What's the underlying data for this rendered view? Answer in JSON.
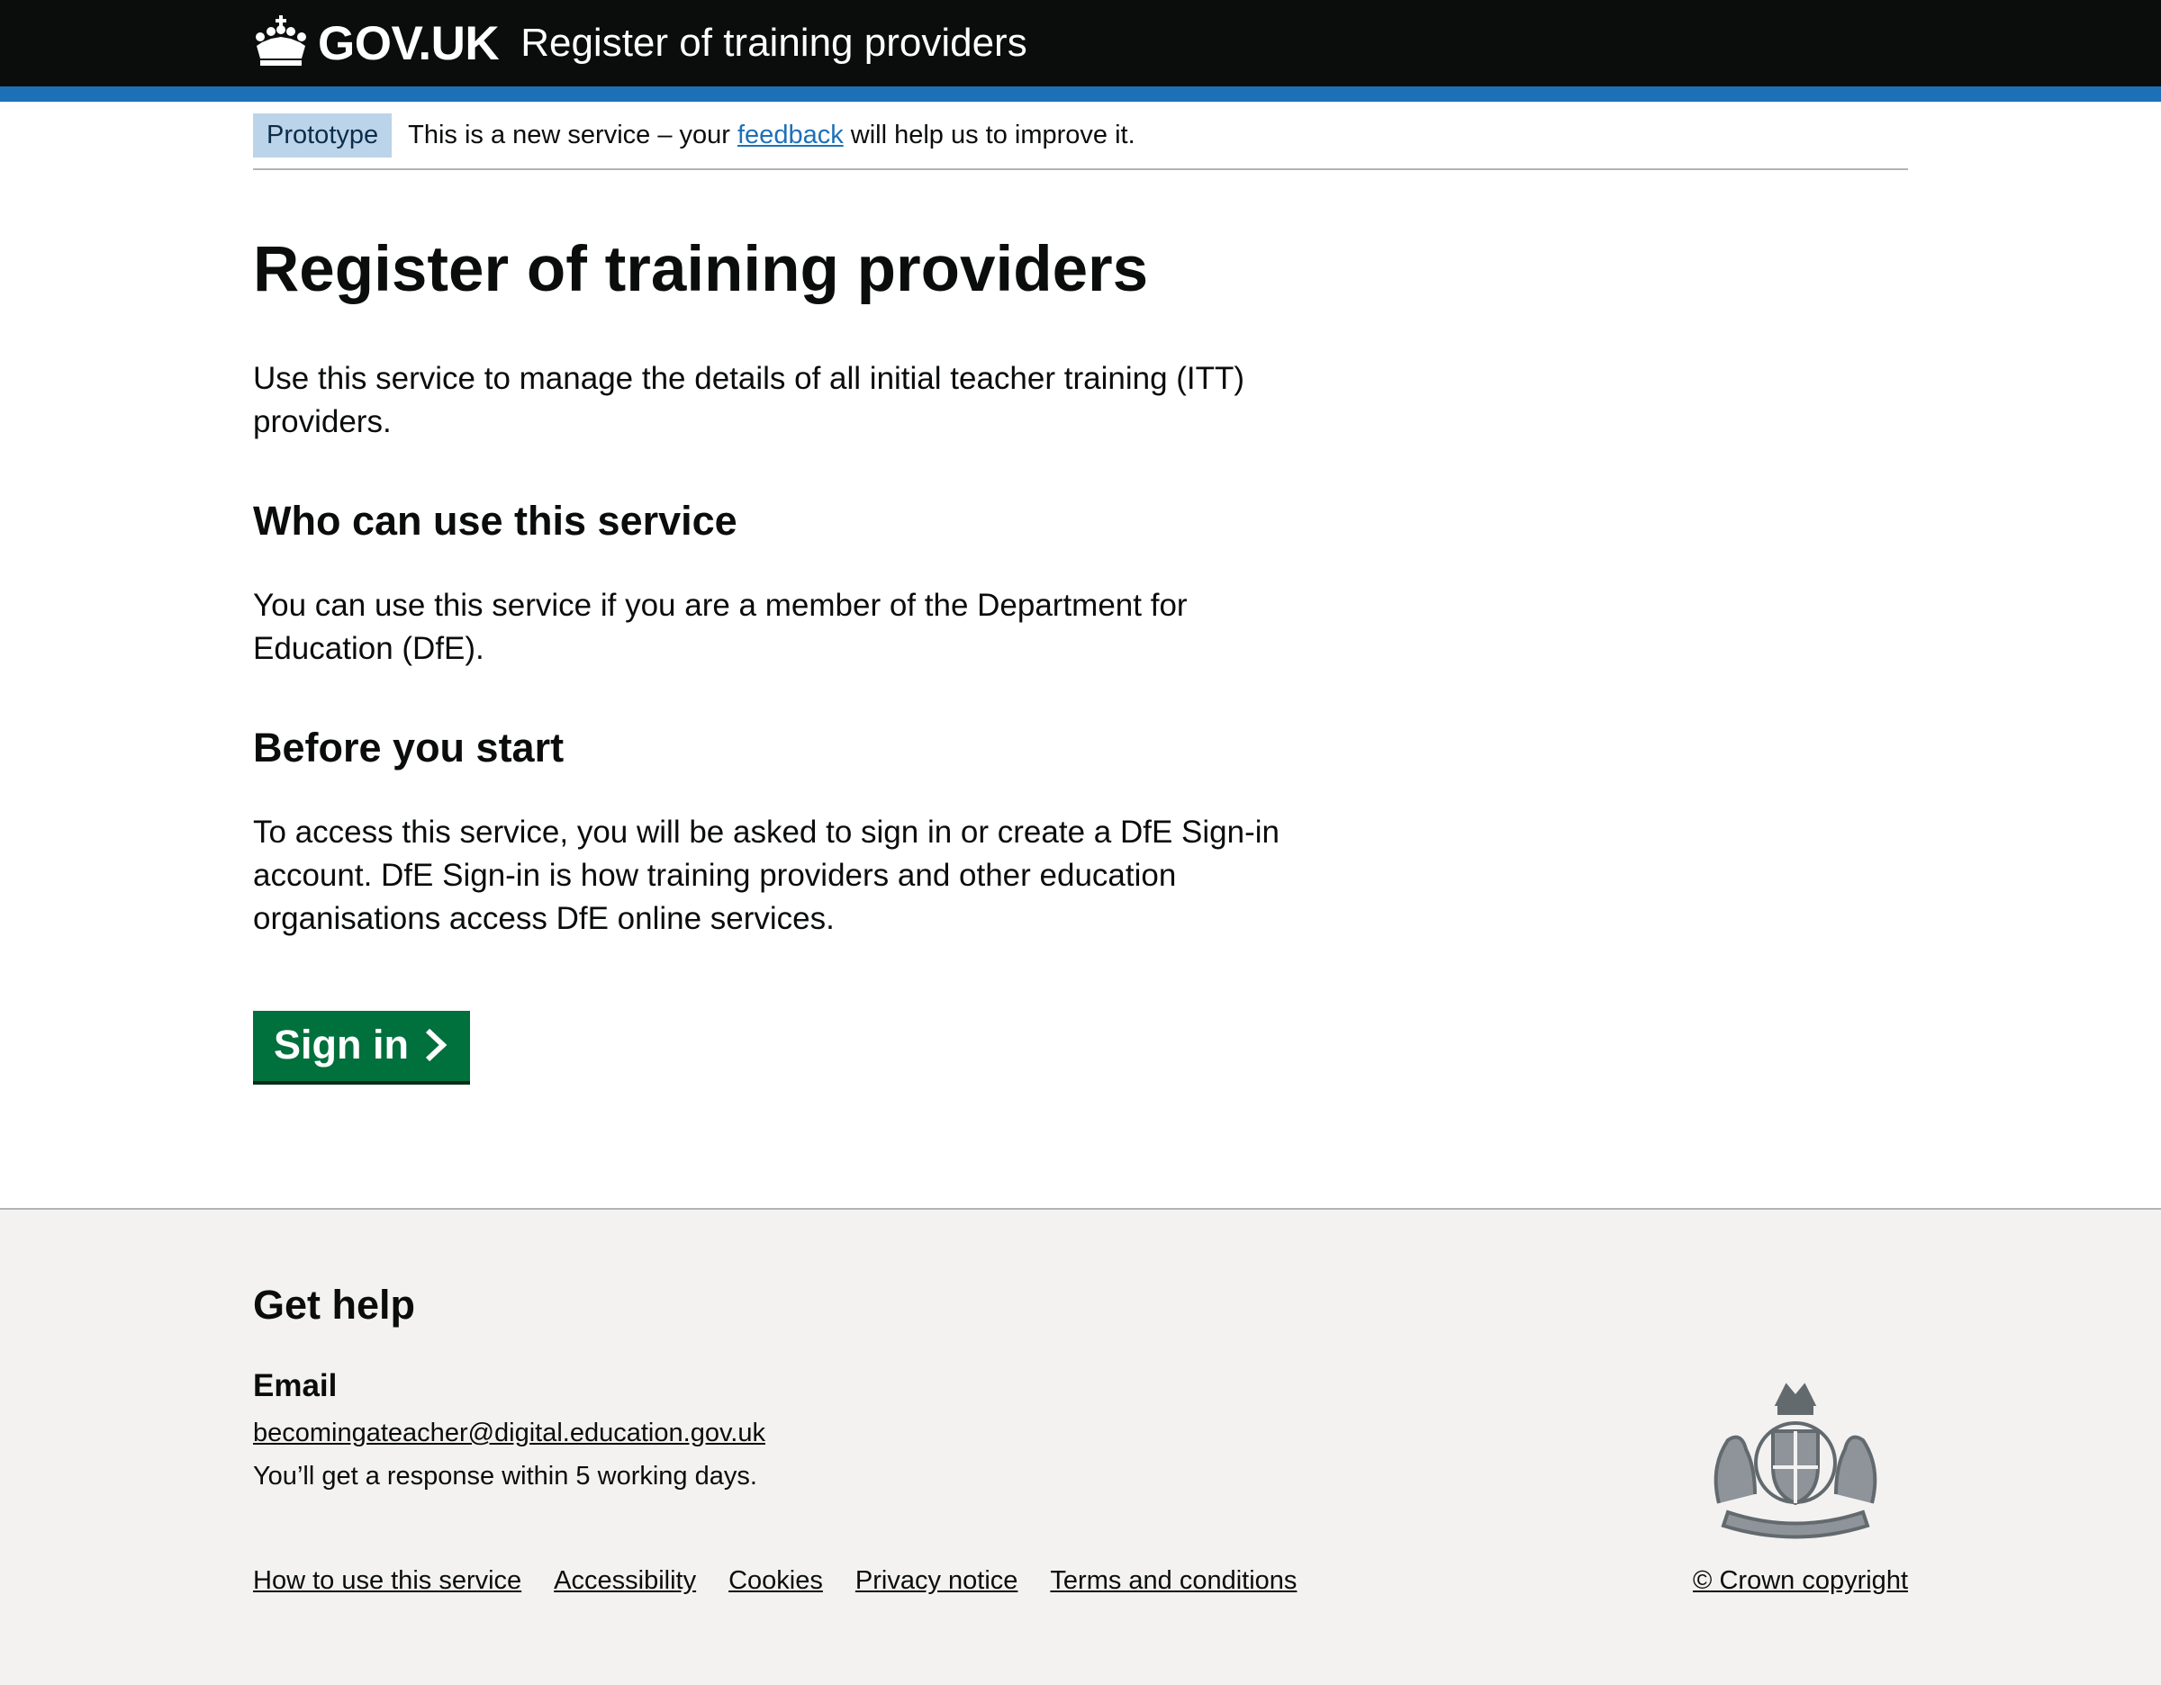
{
  "header": {
    "logo_text": "GOV.UK",
    "service_name": "Register of training providers",
    "accent_color": "#1d70b8",
    "background_color": "#0b0c0c"
  },
  "phase_banner": {
    "tag": "Prototype",
    "text_before": "This is a new service – your ",
    "link_text": "feedback",
    "text_after": " will help us to improve it."
  },
  "main": {
    "title": "Register of training providers",
    "intro": "Use this service to manage the details of all initial teacher training (ITT) providers.",
    "who_heading": "Who can use this service",
    "who_text": "You can use this service if you are a member of the Department for Education (DfE).",
    "before_heading": "Before you start",
    "before_text": "To access this service, you will be asked to sign in or create a DfE Sign-in account. DfE Sign-in is how training providers and other education organisations access DfE online services.",
    "button_label": "Sign in",
    "button_color": "#00703c"
  },
  "footer": {
    "title": "Get help",
    "email_label": "Email",
    "email": "becomingateacher@digital.education.gov.uk",
    "response_note": "You’ll get a response within 5 working days.",
    "links": [
      "How to use this service",
      "Accessibility",
      "Cookies",
      "Privacy notice",
      "Terms and conditions"
    ],
    "copyright": "© Crown copyright",
    "background_color": "#f3f2f1"
  }
}
